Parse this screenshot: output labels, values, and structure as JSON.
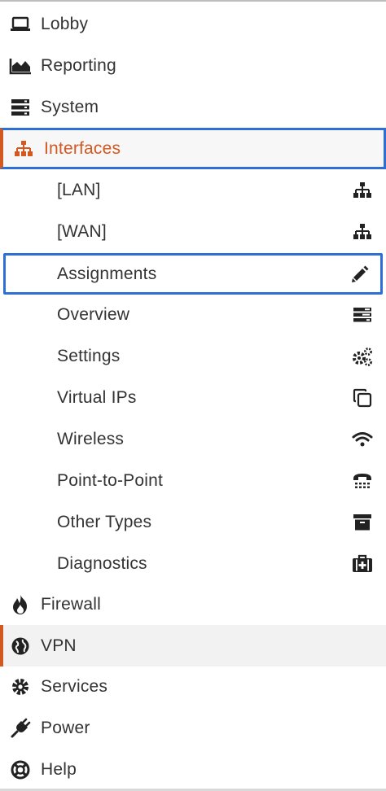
{
  "colors": {
    "accent": "#d35822",
    "focus_outline": "#2e6fd6",
    "text": "#333333",
    "hover_bg": "#f2f2f2"
  },
  "menu": {
    "lobby": {
      "label": "Lobby",
      "icon": "laptop-icon"
    },
    "reporting": {
      "label": "Reporting",
      "icon": "area-chart-icon"
    },
    "system": {
      "label": "System",
      "icon": "server-icon"
    },
    "interfaces": {
      "label": "Interfaces",
      "icon": "sitemap-icon"
    },
    "sub": {
      "lan": {
        "label": "[LAN]",
        "icon": "sitemap-icon"
      },
      "wan": {
        "label": "[WAN]",
        "icon": "sitemap-icon"
      },
      "assignments": {
        "label": "Assignments",
        "icon": "pencil-icon"
      },
      "overview": {
        "label": "Overview",
        "icon": "tasks-icon"
      },
      "settings": {
        "label": "Settings",
        "icon": "cogs-icon"
      },
      "virtual_ips": {
        "label": "Virtual IPs",
        "icon": "clone-icon"
      },
      "wireless": {
        "label": "Wireless",
        "icon": "wifi-icon"
      },
      "point_to_point": {
        "label": "Point-to-Point",
        "icon": "tty-icon"
      },
      "other_types": {
        "label": "Other Types",
        "icon": "archive-icon"
      },
      "diagnostics": {
        "label": "Diagnostics",
        "icon": "medkit-icon"
      }
    },
    "firewall": {
      "label": "Firewall",
      "icon": "fire-icon"
    },
    "vpn": {
      "label": "VPN",
      "icon": "globe-icon"
    },
    "services": {
      "label": "Services",
      "icon": "cog-icon"
    },
    "power": {
      "label": "Power",
      "icon": "plug-icon"
    },
    "help": {
      "label": "Help",
      "icon": "life-ring-icon"
    }
  }
}
